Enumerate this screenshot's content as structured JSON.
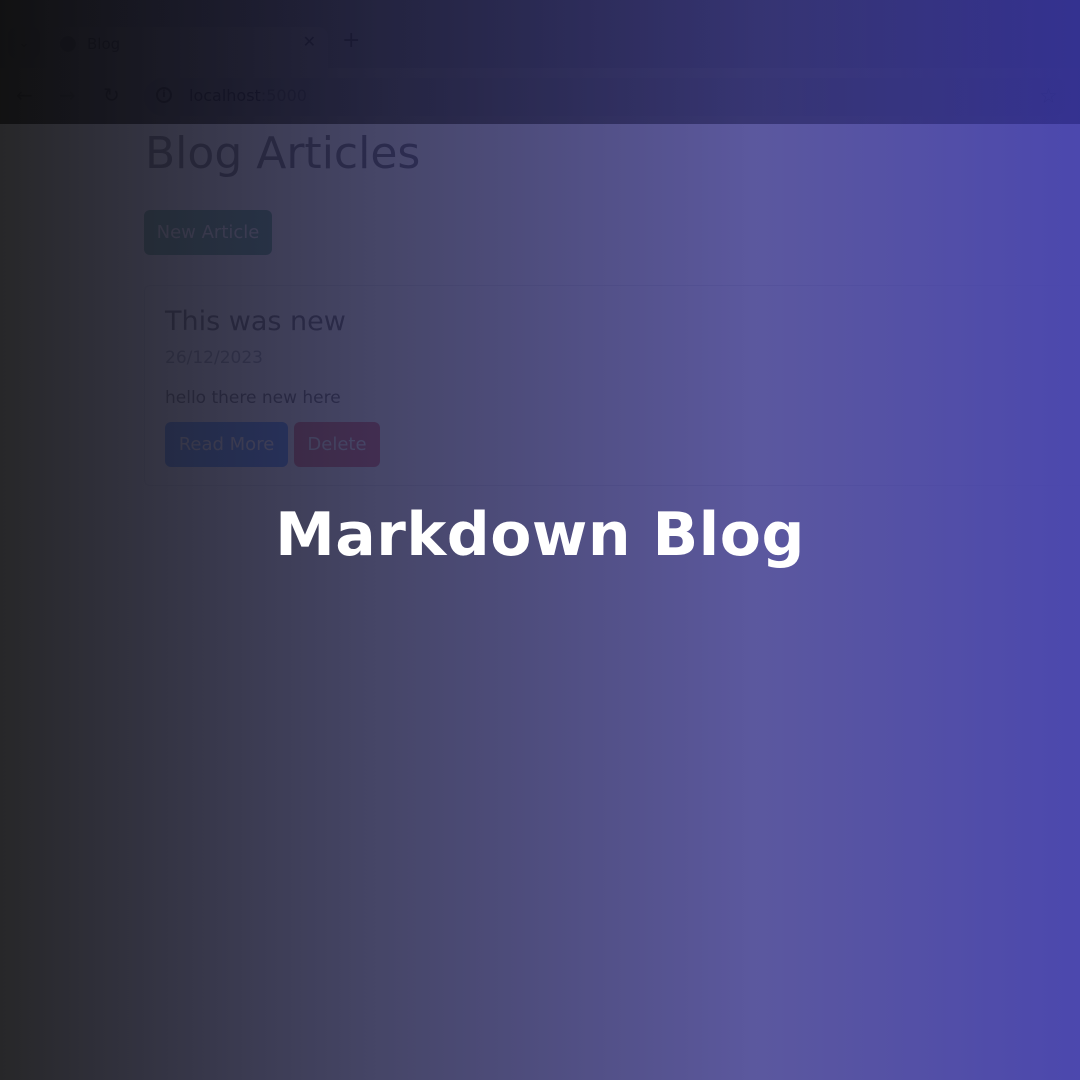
{
  "browser": {
    "tab_title": "Blog",
    "tab_close": "✕",
    "new_tab": "+",
    "url_host": "localhost",
    "url_port": ":5000",
    "icons": {
      "tab_search": "chevron-down-icon",
      "favicon": "globe-icon",
      "back": "arrow-left-icon",
      "forward": "arrow-right-icon",
      "reload": "reload-icon",
      "site_info": "info-icon",
      "bookmark": "star-icon"
    }
  },
  "page": {
    "title": "Blog Articles",
    "new_article_label": "New Article",
    "articles": [
      {
        "title": "This was new",
        "date": "26/12/2023",
        "description": "hello there new here",
        "read_more_label": "Read More",
        "delete_label": "Delete"
      }
    ],
    "colors": {
      "new_button": "#198754",
      "read_more_button": "#0d6efd",
      "delete_button": "#dc3545"
    }
  },
  "overlay": {
    "headline": "Markdown Blog",
    "gradient_start": "#202022",
    "gradient_end": "#4844ac"
  }
}
